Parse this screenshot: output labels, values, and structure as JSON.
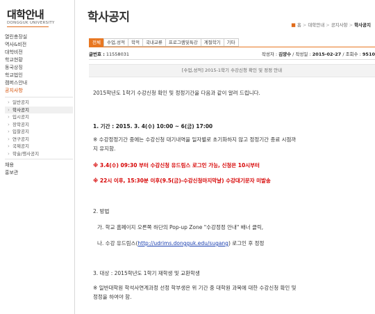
{
  "sidebar": {
    "logo_ko": "대학안내",
    "logo_en": "DONGGUK UNIVERSITY",
    "items_top": [
      "열린총장실",
      "역사&비전",
      "대학비전",
      "학교현황",
      "동국상징",
      "학교법인",
      "캠퍼스안내"
    ],
    "active_item": "공지사항",
    "sub_items": [
      "일반공지",
      "학사공지",
      "입시공지",
      "장학공지",
      "입찰공지",
      "연구공지",
      "국제공지",
      "학술/행사공지"
    ],
    "sub_selected_index": 1,
    "items_bottom": [
      "채용",
      "홍보관"
    ]
  },
  "header": {
    "title": "학사공지",
    "breadcrumb": {
      "home": "홈",
      "level1": "대학안내",
      "level2": "공지사항",
      "current": "학사공지"
    }
  },
  "tabs": [
    "전체",
    "수업,성적",
    "학적",
    "국내교류",
    "프로그램및특강",
    "계절학기",
    "기타"
  ],
  "meta": {
    "post_no_label": "글번호 :",
    "post_no": "11558031",
    "author_label": "작성자 :",
    "author": "김양수",
    "date_label": "작성일 :",
    "date": "2015-02-27",
    "views_label": "조회수 :",
    "views": "9510"
  },
  "post": {
    "title": "[수업,성적] 2015-1학기 수강신청 확인 및 정정 안내",
    "intro": "2015학년도 1학기 수강신청 확인 및 정정기간을 다음과 같이 알려 드립니다.",
    "s1_heading": "1. 기간 : 2015. 3. 4(수) 10:00 ~ 6(금) 17:00",
    "s1_note_1": "※ 수강정정기간 중에는 수강신청 대기내역을 일자별로 초기화하지 않고 정정기간 종료 시점까",
    "s1_note_2": "지 유지함.",
    "s1_red_1": "※  3.4(수) 09:30 부터  수강신청 유드림스 로그인 가능, 신청은 10시부터",
    "s1_red_2": "※  22시 이후, 15:30분 이후(9.5(금)-수강신청마지막날) 수강대기문자 미발송",
    "s2_heading": "2. 방법",
    "s2_a": "가.  학교 홈페이지 오른쪽 하단의 Pop-up Zone \"수강정정 안내\" 배너 클릭,",
    "s2_b_pre": "나.  수강 유드림스(",
    "s2_b_link": "http://udrims.dongguk.edu/sugang",
    "s2_b_post": ") 로그인 후 정정",
    "s3_heading": "3. 대상 : 2015학년도 1학기 재학생 및 교환학생",
    "s3_note_1": "※ 일반대학원 학석사연계과정 선정 학부생은 위 기간 중 대학원 과목에 대한 수강신청 확인 및",
    "s3_note_2": "정정을 하여야 함."
  }
}
